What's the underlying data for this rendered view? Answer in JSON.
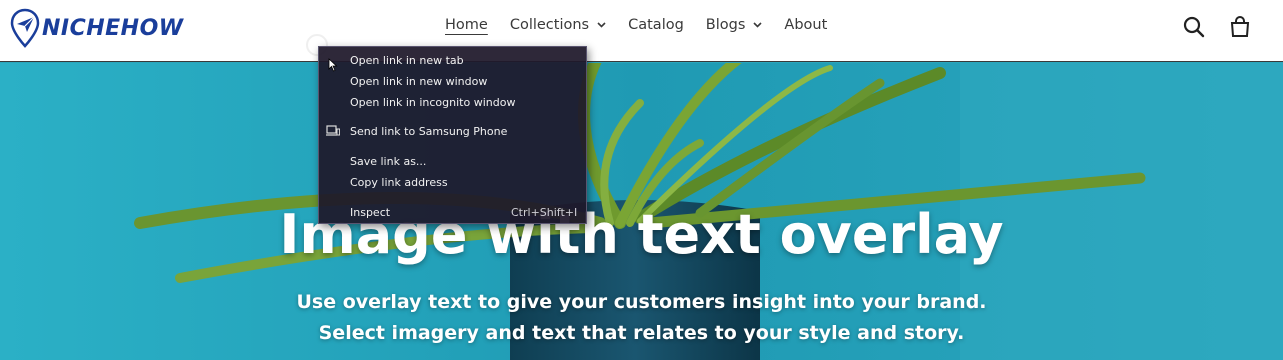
{
  "brand": {
    "name": "NICHEHOW"
  },
  "nav": {
    "items": [
      {
        "label": "Home",
        "active": true,
        "has_dropdown": false
      },
      {
        "label": "Collections",
        "active": false,
        "has_dropdown": true
      },
      {
        "label": "Catalog",
        "active": false,
        "has_dropdown": false
      },
      {
        "label": "Blogs",
        "active": false,
        "has_dropdown": true
      },
      {
        "label": "About",
        "active": false,
        "has_dropdown": false
      }
    ]
  },
  "header_icons": {
    "search": "search-icon",
    "cart": "cart-icon"
  },
  "hero": {
    "title": "Image with text overlay",
    "subtitle_line1": "Use overlay text to give your customers insight into your brand.",
    "subtitle_line2": "Select imagery and text that relates to your style and story."
  },
  "context_menu": {
    "items": [
      {
        "label": "Open link in new tab"
      },
      {
        "label": "Open link in new window"
      },
      {
        "label": "Open link in incognito window"
      },
      {
        "label": "Send link to Samsung Phone",
        "icon": "device-icon"
      },
      {
        "label": "Save link as..."
      },
      {
        "label": "Copy link address"
      },
      {
        "label": "Inspect",
        "shortcut": "Ctrl+Shift+I"
      }
    ]
  },
  "colors": {
    "brand": "#1a3e9b",
    "hero_bg": "#2aa6bd",
    "menu_bg": "#1e182a",
    "nav_text": "#3a3a3a"
  }
}
